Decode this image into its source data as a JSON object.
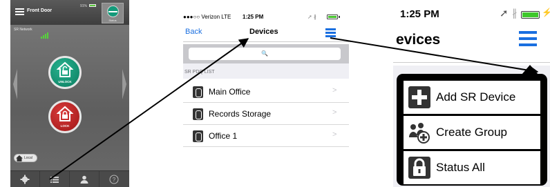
{
  "panel1": {
    "title": "Front Door",
    "battery_pct": "91%",
    "status_label": "Status",
    "network_label": "SR Network",
    "unlock_label": "UNLOCK",
    "lock_label": "LOCK",
    "local_label": "Local",
    "tabs": [
      "settings-icon",
      "list-icon",
      "user-icon",
      "help-icon"
    ],
    "colors": {
      "unlock": "#0f8a6b",
      "lock": "#c12020",
      "signal": "#55d43a"
    }
  },
  "panel2": {
    "status_bar": {
      "carrier": "●●●○○ Verizon  LTE",
      "time": "1:25 PM",
      "icons": "➚ ∦"
    },
    "back_label": "Back",
    "title": "Devices",
    "search_placeholder": "🔍",
    "section_label": "SR PDQ LIST",
    "devices": [
      "Main Office",
      "Records Storage",
      "Office 1"
    ],
    "accent": "#1a6fe0"
  },
  "panel3": {
    "time": "1:25 PM",
    "title": "evices",
    "menu": [
      "Add SR Device",
      "Create Group",
      "Status All"
    ]
  }
}
